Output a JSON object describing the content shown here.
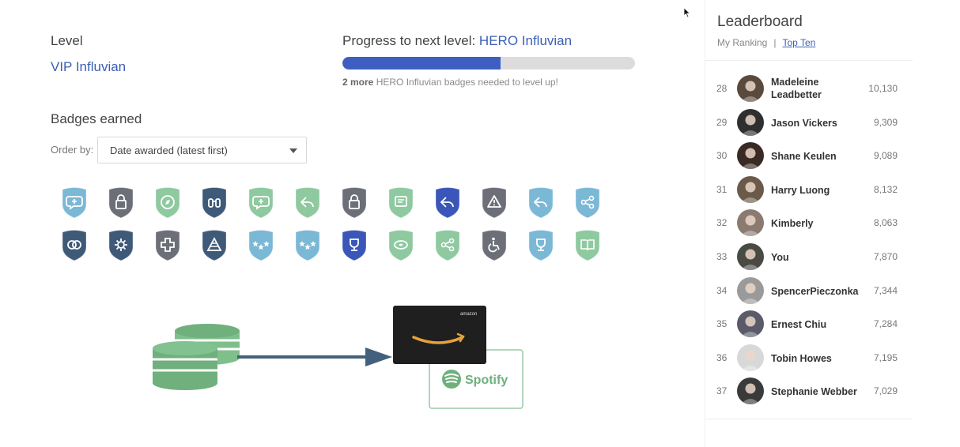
{
  "level": {
    "label": "Level",
    "value": "VIP Influvian"
  },
  "progress": {
    "title_prefix": "Progress to next level: ",
    "next_level": "HERO Influvian",
    "fraction": 0.54,
    "note_count": "2 more",
    "note_rest": " HERO Influvian badges needed to level up!"
  },
  "badges": {
    "title": "Badges earned",
    "order_label": "Order by:",
    "order_value": "Date awarded (latest first)",
    "rows": [
      [
        {
          "name": "chat-add-icon",
          "color": "#7bb8d6"
        },
        {
          "name": "lock-icon",
          "color": "#6c6f78"
        },
        {
          "name": "compass-icon",
          "color": "#8ec9a0"
        },
        {
          "name": "binoculars-icon",
          "color": "#3f5a78"
        },
        {
          "name": "chat-add-icon",
          "color": "#8ec9a0"
        },
        {
          "name": "reply-icon",
          "color": "#8ec9a0"
        },
        {
          "name": "lock-icon",
          "color": "#6c6f78"
        },
        {
          "name": "comment-edit-icon",
          "color": "#8ec9a0"
        },
        {
          "name": "reply-icon",
          "color": "#3a56b8"
        },
        {
          "name": "warning-icon",
          "color": "#6c6f78"
        },
        {
          "name": "reply-icon",
          "color": "#7bb8d6"
        },
        {
          "name": "share-icon",
          "color": "#7bb8d6"
        }
      ],
      [
        {
          "name": "rings-icon",
          "color": "#3f5a78"
        },
        {
          "name": "gear-icon",
          "color": "#3f5a78"
        },
        {
          "name": "plus-icon",
          "color": "#6c6f78"
        },
        {
          "name": "pyramid-icon",
          "color": "#3f5a78"
        },
        {
          "name": "stars-icon",
          "color": "#7bb8d6"
        },
        {
          "name": "stars-icon",
          "color": "#7bb8d6"
        },
        {
          "name": "trophy-icon",
          "color": "#3a56b8"
        },
        {
          "name": "disc-icon",
          "color": "#8ec9a0"
        },
        {
          "name": "share-icon",
          "color": "#8ec9a0"
        },
        {
          "name": "accessibility-icon",
          "color": "#6c6f78"
        },
        {
          "name": "trophy-icon",
          "color": "#7bb8d6"
        },
        {
          "name": "book-icon",
          "color": "#8ec9a0"
        }
      ]
    ]
  },
  "rewards": {
    "gift_card_1": "amazon",
    "gift_card_2": "Spotify"
  },
  "leaderboard": {
    "title": "Leaderboard",
    "tab_my_ranking": "My Ranking",
    "tab_separator": "|",
    "tab_top_ten": "Top Ten",
    "entries": [
      {
        "rank": "28",
        "name": "Madeleine Leadbetter",
        "score": "10,130",
        "avatar_color": "#5a4a3d"
      },
      {
        "rank": "29",
        "name": "Jason Vickers",
        "score": "9,309",
        "avatar_color": "#2f2f2f"
      },
      {
        "rank": "30",
        "name": "Shane Keulen",
        "score": "9,089",
        "avatar_color": "#3a2a24"
      },
      {
        "rank": "31",
        "name": "Harry Luong",
        "score": "8,132",
        "avatar_color": "#6b5a4a"
      },
      {
        "rank": "32",
        "name": "Kimberly",
        "score": "8,063",
        "avatar_color": "#8a7a70"
      },
      {
        "rank": "33",
        "name": "You",
        "score": "7,870",
        "avatar_color": "#4a4a45"
      },
      {
        "rank": "34",
        "name": "SpencerPieczonka",
        "score": "7,344",
        "avatar_color": "#9a9a9a"
      },
      {
        "rank": "35",
        "name": "Ernest Chiu",
        "score": "7,284",
        "avatar_color": "#5a5a6a"
      },
      {
        "rank": "36",
        "name": "Tobin Howes",
        "score": "7,195",
        "avatar_color": "#d8d8d8"
      },
      {
        "rank": "37",
        "name": "Stephanie Webber",
        "score": "7,029",
        "avatar_color": "#3a3a3a"
      }
    ]
  }
}
